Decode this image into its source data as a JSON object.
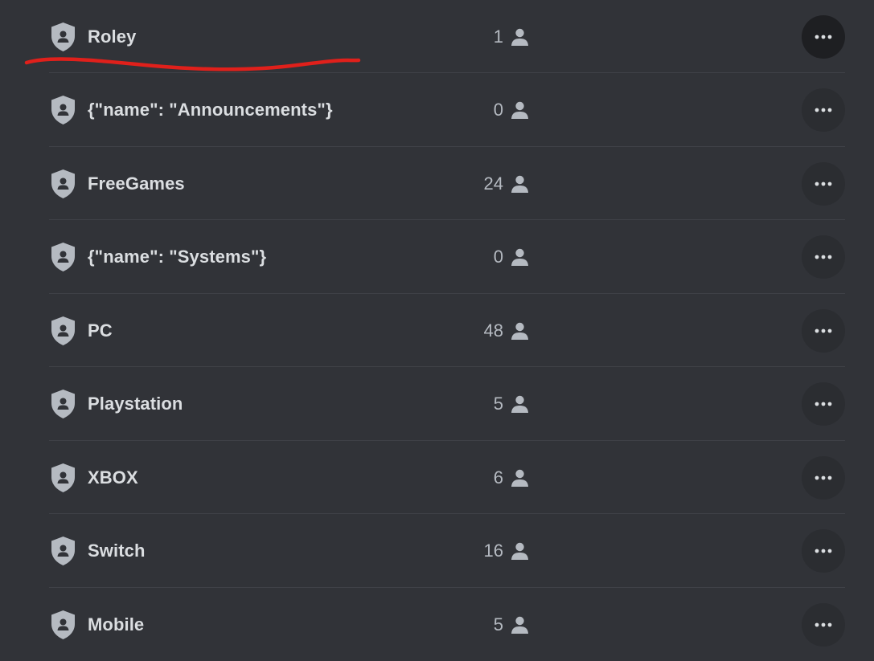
{
  "colors": {
    "background": "#313338",
    "row_divider": "#3f4147",
    "role_name": "#dbdee1",
    "member_count": "#b5bac1",
    "icon": "#b5bac1",
    "more_button": "#2b2d31",
    "more_button_active": "#1e1f22",
    "annotation": "#e0201b"
  },
  "icons": {
    "role": "shield-person-icon",
    "members": "person-icon",
    "more": "ellipsis-horizontal-icon"
  },
  "roles": [
    {
      "name": "Roley",
      "member_count": "1",
      "active": true
    },
    {
      "name": "{\"name\": \"Announcements\"}",
      "member_count": "0"
    },
    {
      "name": "FreeGames",
      "member_count": "24"
    },
    {
      "name": "{\"name\": \"Systems\"}",
      "member_count": "0"
    },
    {
      "name": "PC",
      "member_count": "48"
    },
    {
      "name": "Playstation",
      "member_count": "5"
    },
    {
      "name": "XBOX",
      "member_count": "6"
    },
    {
      "name": "Switch",
      "member_count": "16"
    },
    {
      "name": "Mobile",
      "member_count": "5"
    }
  ]
}
